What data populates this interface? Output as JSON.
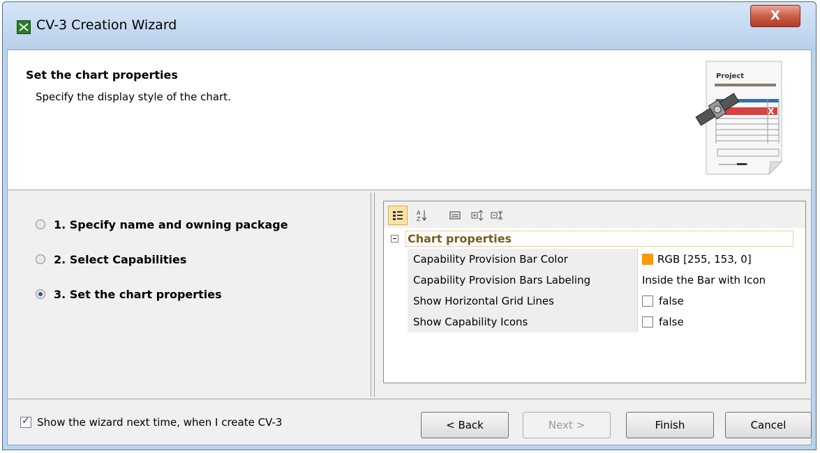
{
  "window": {
    "title": "CV-3 Creation Wizard",
    "close_label": "X"
  },
  "header": {
    "title": "Set the chart properties",
    "subtitle": "Specify the display style of the chart.",
    "image_label": "Project"
  },
  "steps": [
    {
      "label": "1. Specify name and owning package",
      "selected": false
    },
    {
      "label": "2. Select Capabilities",
      "selected": false
    },
    {
      "label": "3. Set the chart properties",
      "selected": true
    }
  ],
  "properties": {
    "group_label": "Chart properties",
    "rows": [
      {
        "name": "Capability Provision Bar Color",
        "value": "RGB [255, 153, 0]",
        "swatch": "#ff9900"
      },
      {
        "name": "Capability Provision Bars Labeling",
        "value": "Inside the Bar with Icon"
      },
      {
        "name": "Show Horizontal Grid Lines",
        "value": "false",
        "checkbox": false
      },
      {
        "name": "Show Capability Icons",
        "value": "false",
        "checkbox": false
      }
    ]
  },
  "footer": {
    "show_wizard_label": "Show the wizard next time, when I create CV-3",
    "show_wizard_checked": true,
    "back_label": "< Back",
    "next_label": "Next >",
    "finish_label": "Finish",
    "cancel_label": "Cancel"
  },
  "colors": {
    "titlebar": "#bcd3ec",
    "bar_color": "#ff9900",
    "close_button": "#c75a42"
  }
}
